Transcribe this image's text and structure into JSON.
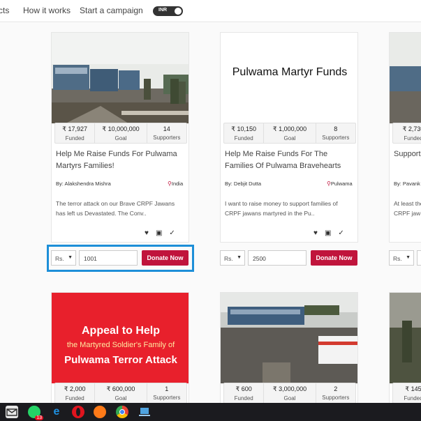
{
  "nav": {
    "links": [
      "cts",
      "How it works",
      "Start a campaign"
    ],
    "currency_toggle": "INR"
  },
  "colors": {
    "accent": "#c0143c",
    "highlight": "#1d8fd8",
    "taskbar": "#1b1b1f"
  },
  "cards": [
    {
      "stats": [
        {
          "value": "₹ 17,927",
          "label": "Funded"
        },
        {
          "value": "₹ 10,000,000",
          "label": "Goal"
        },
        {
          "value": "14",
          "label": "Supporters"
        }
      ],
      "title": "Help Me Raise Funds For Pulwama Martyrs Families!",
      "author": "By: Alakshendra Mishra",
      "location": "India",
      "description": "The terror attack on our Brave CRPF Jawans has left us Devastated. The Conv.."
    },
    {
      "image_text": "Pulwama Martyr Funds",
      "stats": [
        {
          "value": "₹ 10,150",
          "label": "Funded"
        },
        {
          "value": "₹ 1,000,000",
          "label": "Goal"
        },
        {
          "value": "8",
          "label": "Supporters"
        }
      ],
      "title": "Help Me Raise Funds For The Families Of Pulwama Bravehearts",
      "author": "By: Debjit Dutta",
      "location": "Pulwama",
      "description": "I want to raise money to support families of CRPF jawans martyred in the Pu.."
    },
    {
      "stats": [
        {
          "value": "₹ 2,730",
          "label": "Funded"
        }
      ],
      "title": "Support",
      "author": "By: Pavank",
      "description": "At least the CRPF jaw"
    }
  ],
  "donate_rows": [
    {
      "currency": "Rs.",
      "amount": "1001",
      "button": "Donate Now"
    },
    {
      "currency": "Rs.",
      "amount": "2500",
      "button": "Donate Now"
    },
    {
      "currency": "Rs."
    }
  ],
  "cards_row2": [
    {
      "poster": {
        "line1": "Appeal to Help",
        "line2": "the Martyred Soldier's Family of",
        "line3": "Pulwama Terror Attack"
      },
      "stats": [
        {
          "value": "₹ 2,000",
          "label": "Funded"
        },
        {
          "value": "₹ 600,000",
          "label": "Goal"
        },
        {
          "value": "1",
          "label": "Supporters"
        }
      ]
    },
    {
      "stats": [
        {
          "value": "₹ 600",
          "label": "Funded"
        },
        {
          "value": "₹ 3,000,000",
          "label": "Goal"
        },
        {
          "value": "2",
          "label": "Supporters"
        }
      ]
    },
    {
      "stats": [
        {
          "value": "₹ 145",
          "label": "Funded"
        }
      ]
    }
  ],
  "taskbar": {
    "icons": [
      "mail-icon",
      "whatsapp-icon",
      "edge-icon",
      "opera-icon",
      "firefox-icon",
      "chrome-icon",
      "laptop-icon"
    ],
    "whatsapp_badge": "13"
  }
}
